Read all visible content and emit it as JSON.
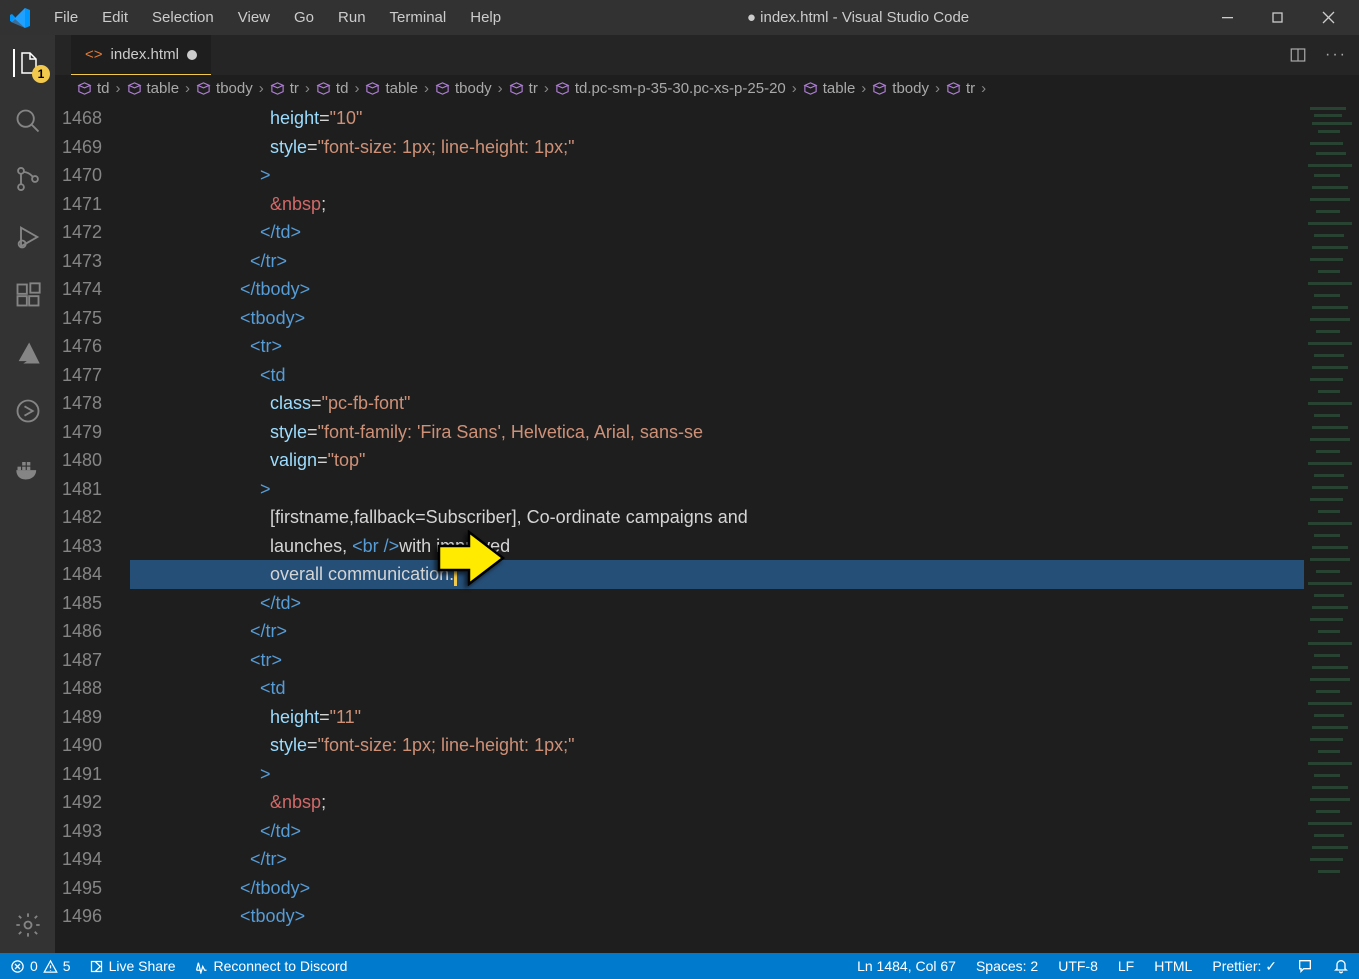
{
  "title": "● index.html - Visual Studio Code",
  "menu": [
    "File",
    "Edit",
    "Selection",
    "View",
    "Go",
    "Run",
    "Terminal",
    "Help"
  ],
  "tab": {
    "name": "index.html",
    "dirty": true
  },
  "explorer_badge": "1",
  "breadcrumb": [
    "td",
    "table",
    "tbody",
    "tr",
    "td",
    "table",
    "tbody",
    "tr",
    "td.pc-sm-p-35-30.pc-xs-p-25-20",
    "table",
    "tbody",
    "tr"
  ],
  "lines": [
    {
      "n": 1468,
      "ind": 14,
      "html": "<span class='t-attr'>height</span><span class='t-txt'>=</span><span class='t-str'>\"10\"</span>"
    },
    {
      "n": 1469,
      "ind": 14,
      "html": "<span class='t-attr'>style</span><span class='t-txt'>=</span><span class='t-str'>\"font-size: 1px; line-height: 1px;\"</span>"
    },
    {
      "n": 1470,
      "ind": 13,
      "html": "<span class='t-tag'>&gt;</span>"
    },
    {
      "n": 1471,
      "ind": 14,
      "html": "<span class='t-ent'>&amp;nbsp</span><span class='t-txt'>;</span>"
    },
    {
      "n": 1472,
      "ind": 13,
      "html": "<span class='t-tag'>&lt;/td&gt;</span>"
    },
    {
      "n": 1473,
      "ind": 12,
      "html": "<span class='t-tag'>&lt;/tr&gt;</span>"
    },
    {
      "n": 1474,
      "ind": 11,
      "html": "<span class='t-tag'>&lt;/tbody&gt;</span>"
    },
    {
      "n": 1475,
      "ind": 11,
      "html": "<span class='t-tag'>&lt;tbody&gt;</span>"
    },
    {
      "n": 1476,
      "ind": 12,
      "html": "<span class='t-tag'>&lt;tr&gt;</span>"
    },
    {
      "n": 1477,
      "ind": 13,
      "html": "<span class='t-tag'>&lt;td</span>"
    },
    {
      "n": 1478,
      "ind": 14,
      "html": "<span class='t-attr'>class</span><span class='t-txt'>=</span><span class='t-str'>\"pc-fb-font\"</span>"
    },
    {
      "n": 1479,
      "ind": 14,
      "html": "<span class='t-attr'>style</span><span class='t-txt'>=</span><span class='t-str'>\"font-family: 'Fira Sans', Helvetica, Arial, sans-se</span>"
    },
    {
      "n": 1480,
      "ind": 14,
      "html": "<span class='t-attr'>valign</span><span class='t-txt'>=</span><span class='t-str'>\"top\"</span>"
    },
    {
      "n": 1481,
      "ind": 13,
      "html": "<span class='t-tag'>&gt;</span>"
    },
    {
      "n": 1482,
      "ind": 14,
      "html": "<span class='t-txt'>[firstname,fallback=Subscriber], Co-ordinate campaigns and</span>"
    },
    {
      "n": 1483,
      "ind": 14,
      "html": "<span class='t-txt'>launches, </span><span class='t-tag'>&lt;br /&gt;</span><span class='t-txt'>with improved</span>"
    },
    {
      "n": 1484,
      "ind": 14,
      "sel": true,
      "html": "<span class='t-txt'>overall communication.</span><span class='cursor'></span>"
    },
    {
      "n": 1485,
      "ind": 13,
      "html": "<span class='t-tag'>&lt;/td&gt;</span>"
    },
    {
      "n": 1486,
      "ind": 12,
      "html": "<span class='t-tag'>&lt;/tr&gt;</span>"
    },
    {
      "n": 1487,
      "ind": 12,
      "html": "<span class='t-tag'>&lt;tr&gt;</span>"
    },
    {
      "n": 1488,
      "ind": 13,
      "html": "<span class='t-tag'>&lt;td</span>"
    },
    {
      "n": 1489,
      "ind": 14,
      "html": "<span class='t-attr'>height</span><span class='t-txt'>=</span><span class='t-str'>\"11\"</span>"
    },
    {
      "n": 1490,
      "ind": 14,
      "html": "<span class='t-attr'>style</span><span class='t-txt'>=</span><span class='t-str'>\"font-size: 1px; line-height: 1px;\"</span>"
    },
    {
      "n": 1491,
      "ind": 13,
      "html": "<span class='t-tag'>&gt;</span>"
    },
    {
      "n": 1492,
      "ind": 14,
      "html": "<span class='t-ent'>&amp;nbsp</span><span class='t-txt'>;</span>"
    },
    {
      "n": 1493,
      "ind": 13,
      "html": "<span class='t-tag'>&lt;/td&gt;</span>"
    },
    {
      "n": 1494,
      "ind": 12,
      "html": "<span class='t-tag'>&lt;/tr&gt;</span>"
    },
    {
      "n": 1495,
      "ind": 11,
      "html": "<span class='t-tag'>&lt;/tbody&gt;</span>"
    },
    {
      "n": 1496,
      "ind": 11,
      "html": "<span class='t-tag'>&lt;tbody&gt;</span>"
    }
  ],
  "status": {
    "errors": "0",
    "warnings": "5",
    "liveshare": "Live Share",
    "discord": "Reconnect to Discord",
    "pos": "Ln 1484, Col 67",
    "spaces": "Spaces: 2",
    "enc": "UTF-8",
    "eol": "LF",
    "lang": "HTML",
    "prettier": "Prettier: ✓"
  }
}
